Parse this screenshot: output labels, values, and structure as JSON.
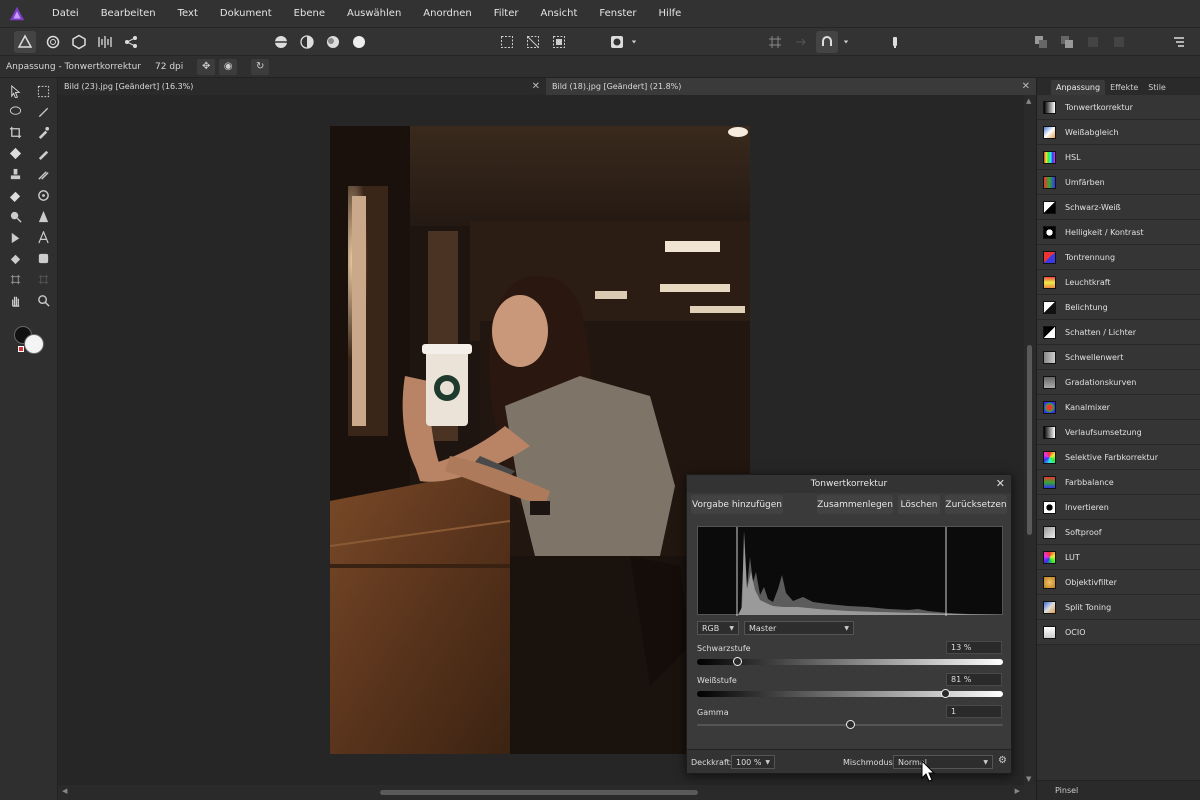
{
  "menu": [
    "Datei",
    "Bearbeiten",
    "Text",
    "Dokument",
    "Ebene",
    "Auswählen",
    "Anordnen",
    "Filter",
    "Ansicht",
    "Fenster",
    "Hilfe"
  ],
  "context": {
    "label": "Anpassung - Tonwertkorrektur",
    "dpi": "72 dpi"
  },
  "doc_tabs": [
    {
      "label": "Bild (23).jpg [Geändert] (16.3%)"
    },
    {
      "label": "Bild (18).jpg [Geändert] (21.8%)"
    }
  ],
  "panel": {
    "tabs": [
      "Anpassung",
      "Effekte",
      "Stile"
    ],
    "items": [
      {
        "label": "Tonwertkorrektur",
        "icon": "levels-icon"
      },
      {
        "label": "Weißabgleich",
        "icon": "white-balance-icon"
      },
      {
        "label": "HSL",
        "icon": "hsl-icon"
      },
      {
        "label": "Umfärben",
        "icon": "recolor-icon"
      },
      {
        "label": "Schwarz-Weiß",
        "icon": "black-white-icon"
      },
      {
        "label": "Helligkeit / Kontrast",
        "icon": "brightness-contrast-icon"
      },
      {
        "label": "Tontrennung",
        "icon": "posterize-icon"
      },
      {
        "label": "Leuchtkraft",
        "icon": "vibrance-icon"
      },
      {
        "label": "Belichtung",
        "icon": "exposure-icon"
      },
      {
        "label": "Schatten / Lichter",
        "icon": "shadows-highlights-icon"
      },
      {
        "label": "Schwellenwert",
        "icon": "threshold-icon"
      },
      {
        "label": "Gradationskurven",
        "icon": "curves-icon"
      },
      {
        "label": "Kanalmixer",
        "icon": "channel-mixer-icon"
      },
      {
        "label": "Verlaufsumsetzung",
        "icon": "gradient-map-icon"
      },
      {
        "label": "Selektive Farbkorrektur",
        "icon": "selective-color-icon"
      },
      {
        "label": "Farbbalance",
        "icon": "color-balance-icon"
      },
      {
        "label": "Invertieren",
        "icon": "invert-icon"
      },
      {
        "label": "Softproof",
        "icon": "soft-proof-icon"
      },
      {
        "label": "LUT",
        "icon": "lut-icon"
      },
      {
        "label": "Objektivfilter",
        "icon": "lens-filter-icon"
      },
      {
        "label": "Split Toning",
        "icon": "split-toning-icon"
      },
      {
        "label": "OCIO",
        "icon": "ocio-icon"
      }
    ],
    "footer": "Pinsel"
  },
  "dialog": {
    "title": "Tonwertkorrektur",
    "buttons": {
      "add_preset": "Vorgabe hinzufügen",
      "merge": "Zusammenlegen",
      "delete": "Löschen",
      "reset": "Zurücksetzen"
    },
    "channel": "RGB",
    "mode": "Master",
    "black_label": "Schwarzstufe",
    "black_value": "13 %",
    "white_label": "Weißstufe",
    "white_value": "81 %",
    "gamma_label": "Gamma",
    "gamma_value": "1",
    "opacity_label": "Deckkraft:",
    "opacity_value": "100 %",
    "blend_label": "Mischmodus:",
    "blend_value": "Normal"
  },
  "levels": {
    "black": 0.13,
    "white": 0.81,
    "gamma": 1.0
  }
}
